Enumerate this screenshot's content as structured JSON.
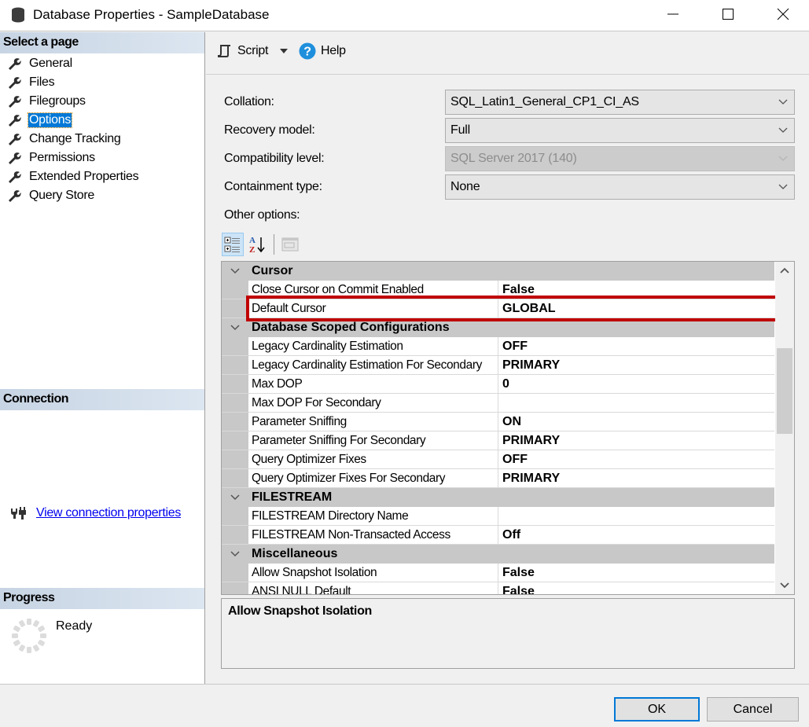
{
  "window": {
    "title": "Database Properties - SampleDatabase",
    "app_icon": "database-icon",
    "controls": [
      "minimize-icon",
      "maximize-icon",
      "close-icon"
    ]
  },
  "left_pane": {
    "select_page_header": "Select a page",
    "pages": [
      {
        "label": "General",
        "icon": "wrench-icon",
        "selected": false
      },
      {
        "label": "Files",
        "icon": "wrench-icon",
        "selected": false
      },
      {
        "label": "Filegroups",
        "icon": "wrench-icon",
        "selected": false
      },
      {
        "label": "Options",
        "icon": "wrench-icon",
        "selected": true
      },
      {
        "label": "Change Tracking",
        "icon": "wrench-icon",
        "selected": false
      },
      {
        "label": "Permissions",
        "icon": "wrench-icon",
        "selected": false
      },
      {
        "label": "Extended Properties",
        "icon": "wrench-icon",
        "selected": false
      },
      {
        "label": "Query Store",
        "icon": "wrench-icon",
        "selected": false
      }
    ],
    "connection_header": "Connection",
    "connection_link": "View connection properties",
    "progress_header": "Progress",
    "progress_status": "Ready"
  },
  "toolbar": {
    "script_label": "Script",
    "help_label": "Help"
  },
  "form": {
    "collation": {
      "label": "Collation:",
      "value": "SQL_Latin1_General_CP1_CI_AS"
    },
    "recovery_model": {
      "label": "Recovery model:",
      "value": "Full"
    },
    "compatibility_level": {
      "label": "Compatibility level:",
      "value": "SQL Server 2017 (140)",
      "disabled": true
    },
    "containment_type": {
      "label": "Containment type:",
      "value": "None"
    },
    "other_options_label": "Other options:"
  },
  "property_grid": {
    "categories": [
      {
        "name": "Cursor",
        "rows": [
          {
            "name": "Close Cursor on Commit Enabled",
            "value": "False"
          },
          {
            "name": "Default Cursor",
            "value": "GLOBAL",
            "highlighted": true
          }
        ]
      },
      {
        "name": "Database Scoped Configurations",
        "rows": [
          {
            "name": "Legacy Cardinality Estimation",
            "value": "OFF"
          },
          {
            "name": "Legacy Cardinality Estimation For Secondary",
            "value": "PRIMARY"
          },
          {
            "name": "Max DOP",
            "value": "0"
          },
          {
            "name": "Max DOP For Secondary",
            "value": ""
          },
          {
            "name": "Parameter Sniffing",
            "value": "ON"
          },
          {
            "name": "Parameter Sniffing For Secondary",
            "value": "PRIMARY"
          },
          {
            "name": "Query Optimizer Fixes",
            "value": "OFF"
          },
          {
            "name": "Query Optimizer Fixes For Secondary",
            "value": "PRIMARY"
          }
        ]
      },
      {
        "name": "FILESTREAM",
        "rows": [
          {
            "name": "FILESTREAM Directory Name",
            "value": ""
          },
          {
            "name": "FILESTREAM Non-Transacted Access",
            "value": "Off"
          }
        ]
      },
      {
        "name": "Miscellaneous",
        "rows": [
          {
            "name": "Allow Snapshot Isolation",
            "value": "False"
          },
          {
            "name": "ANSI NULL Default",
            "value": "False"
          }
        ]
      }
    ],
    "description_title": "Allow Snapshot Isolation"
  },
  "buttons": {
    "ok": "OK",
    "cancel": "Cancel"
  },
  "colors": {
    "selection": "#0078d7",
    "highlight_box": "#c00000",
    "category_bg": "#c8c8c8",
    "link": "#0000ee"
  }
}
